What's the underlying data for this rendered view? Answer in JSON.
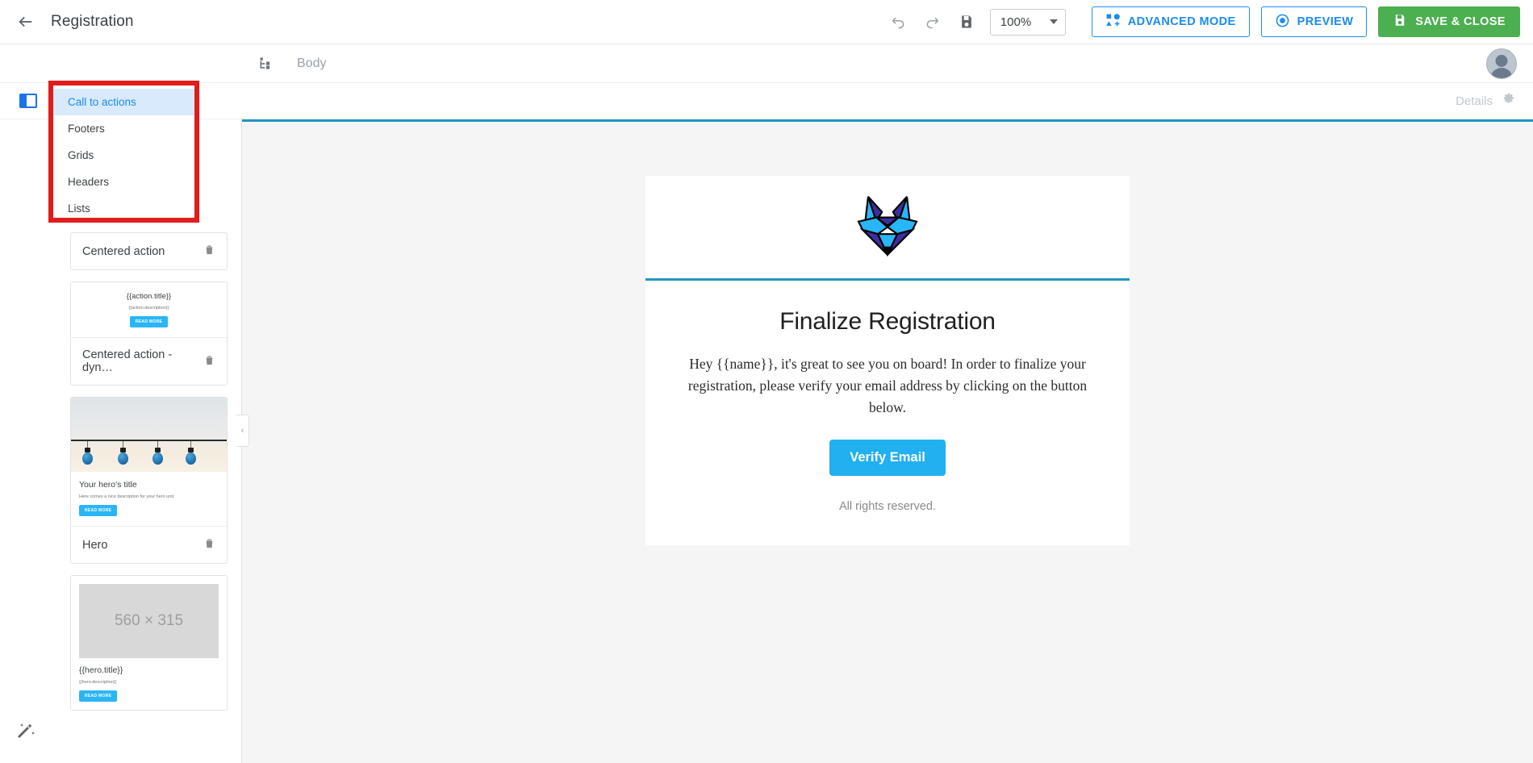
{
  "topbar": {
    "back_icon": "back-arrow-icon",
    "title": "Registration",
    "undo_icon": "undo-icon",
    "redo_icon": "redo-icon",
    "save_icon": "save-disk-icon",
    "zoom_value": "100%",
    "advanced_mode_label": "ADVANCED MODE",
    "advanced_mode_icon": "advanced-mode-icon",
    "preview_label": "PREVIEW",
    "preview_icon": "eye-icon",
    "save_close_label": "SAVE & CLOSE",
    "save_close_icon": "save-disk-icon",
    "save_close_color": "#4caf50",
    "accent_color": "#1a8cf0"
  },
  "subbar": {
    "tree_icon": "structure-tree-icon",
    "breadcrumb": "Body",
    "avatar": "user-avatar"
  },
  "detailsbar": {
    "panel_icon": "layout-panel-icon",
    "details_label": "Details",
    "gear_icon": "gear-icon"
  },
  "dropdown": {
    "highlight_color": "#e21b1b",
    "items": [
      {
        "label": "Call to actions",
        "active": true
      },
      {
        "label": "Footers",
        "active": false
      },
      {
        "label": "Grids",
        "active": false
      },
      {
        "label": "Headers",
        "active": false
      },
      {
        "label": "Lists",
        "active": false
      }
    ]
  },
  "sidebar": {
    "magic_icon": "magic-wand-icon",
    "collapse_icon": "‹",
    "blocks": [
      {
        "name": "Centered action",
        "trash_icon": "trash-icon",
        "preview": null
      },
      {
        "name": "Centered action - dyn…",
        "trash_icon": "trash-icon",
        "preview": {
          "type": "centered",
          "title": "{{action.title}}",
          "description": "{{action.description}}",
          "button": "READ MORE"
        }
      },
      {
        "name": "Hero",
        "trash_icon": "trash-icon",
        "preview": {
          "type": "hero-image",
          "image_alt": "string-lights-photo",
          "title": "Your hero's title",
          "description": "Here comes a nice description for your hero unit.",
          "button": "READ MORE"
        }
      },
      {
        "name": "",
        "trash_icon": "trash-icon",
        "preview": {
          "type": "hero-placeholder",
          "placeholder": "560 × 315",
          "title": "{{hero.title}}",
          "description": "{{hero.description}}",
          "button": "READ MORE"
        }
      }
    ]
  },
  "email": {
    "logo_alt": "fox-head-logo",
    "accent_line_color": "#2196c4",
    "heading": "Finalize Registration",
    "paragraph": "Hey {{name}}, it's great to see you on board! In order to finalize your registration, please verify your email address by clicking on the button below.",
    "cta_label": "Verify Email",
    "cta_color": "#21b0f0",
    "footer": "All rights reserved."
  }
}
